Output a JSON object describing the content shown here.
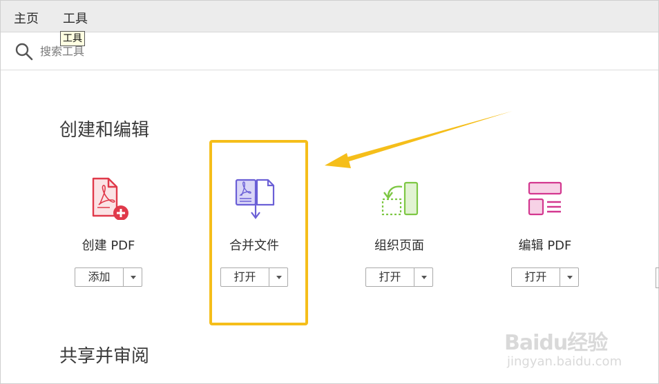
{
  "menubar": {
    "items": [
      {
        "label": "主页"
      },
      {
        "label": "工具"
      }
    ],
    "tooltip": "工具"
  },
  "search": {
    "placeholder": "搜索工具",
    "icon": "search-icon"
  },
  "sections": [
    {
      "title": "创建和编辑",
      "tools": [
        {
          "label": "创建 PDF",
          "button": "添加",
          "icon": "create-pdf-icon",
          "color": "#e0394a"
        },
        {
          "label": "合并文件",
          "button": "打开",
          "icon": "combine-files-icon",
          "color": "#6a5fd6"
        },
        {
          "label": "组织页面",
          "button": "打开",
          "icon": "organize-pages-icon",
          "color": "#7dc743"
        },
        {
          "label": "编辑 PDF",
          "button": "打开",
          "icon": "edit-pdf-icon",
          "color": "#d3378f"
        }
      ]
    },
    {
      "title": "共享并审阅",
      "tools": []
    }
  ],
  "annotation": {
    "highlight_color": "#f5be1a",
    "highlighted_tool": "合并文件"
  },
  "watermark": {
    "main": "Baidu经验",
    "sub": "jingyan.baidu.com"
  }
}
